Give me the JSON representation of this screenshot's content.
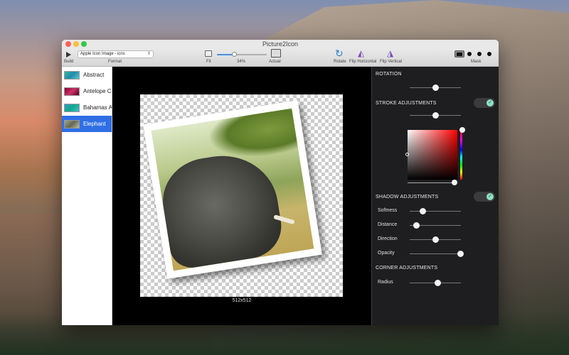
{
  "window": {
    "title": "Picture2Icon"
  },
  "toolbar": {
    "build_label": "Build",
    "format": {
      "label": "Format",
      "value": "Apple Icon Image - icns"
    },
    "fit_label": "Fit",
    "zoom": {
      "value_text": "34%",
      "fraction": 0.34
    },
    "actual_label": "Actual",
    "rotate_label": "Rotate",
    "flip_horizontal_label": "Flip Horizontal",
    "flip_vertical_label": "Flip Vertical",
    "mask_label": "Mask"
  },
  "sidebar": {
    "items": [
      {
        "label": "Abstract",
        "selected": false
      },
      {
        "label": "Antelope Ca",
        "selected": false
      },
      {
        "label": "Bahamas Ae",
        "selected": false
      },
      {
        "label": "Elephant",
        "selected": true
      }
    ]
  },
  "canvas": {
    "size_label": "512x512"
  },
  "panel": {
    "rotation": {
      "title": "ROTATION",
      "value": 0.5
    },
    "stroke": {
      "title": "STROKE ADJUSTMENTS",
      "enabled": true,
      "width": 0.5
    },
    "shadow": {
      "title": "SHADOW ADJUSTMENTS",
      "enabled": true,
      "softness": {
        "label": "Softness",
        "value": 0.25
      },
      "distance": {
        "label": "Distance",
        "value": 0.12
      },
      "direction": {
        "label": "Direction",
        "value": 0.5
      },
      "opacity": {
        "label": "Opacity",
        "value": 0.98
      }
    },
    "corner": {
      "title": "CORNER ADJUSTMENTS",
      "radius": {
        "label": "Radius",
        "value": 0.54
      }
    }
  },
  "colors": {
    "accent": "#2f6fe6",
    "toggle_on": "#8fe0c0"
  }
}
